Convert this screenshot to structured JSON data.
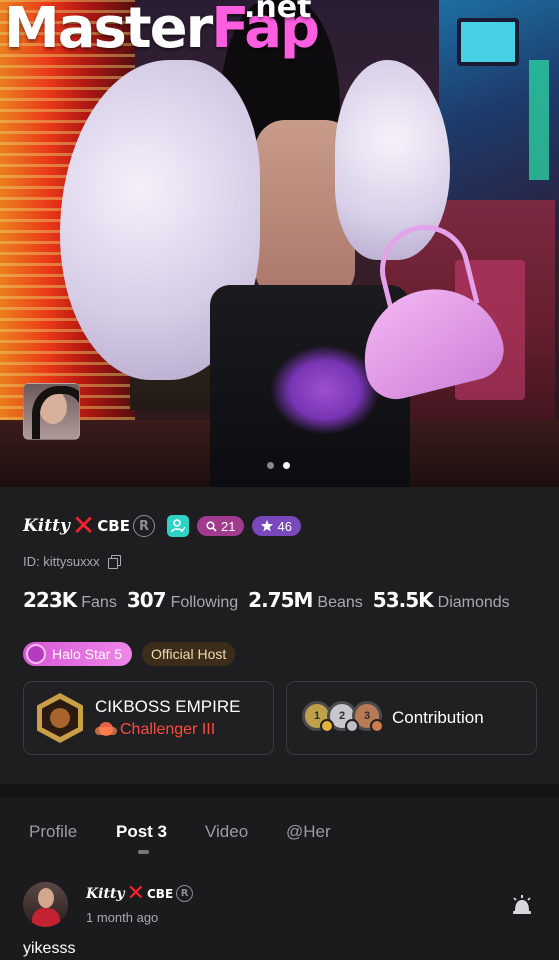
{
  "watermark": {
    "master": "Master",
    "fap": "Fap",
    "net": ".net"
  },
  "gallery": {
    "dot_count": 2,
    "active_dot": 2
  },
  "profile": {
    "name_script": "Kitty",
    "name_x": "✕",
    "name_tag": "CBE",
    "registered_symbol": "R",
    "level_badge": "21",
    "star_badge": "46",
    "id_text": "ID: kittysuxxx",
    "stats": [
      {
        "value": "223K",
        "label": "Fans"
      },
      {
        "value": "307",
        "label": "Following"
      },
      {
        "value": "2.75M",
        "label": "Beans"
      },
      {
        "value": "53.5K",
        "label": "Diamonds"
      }
    ],
    "halo_tag": "Halo Star 5",
    "host_tag": "Official Host",
    "family": {
      "name": "CIKBOSS EMPIRE",
      "rank": "Challenger III"
    },
    "contribution": {
      "label": "Contribution",
      "medals": [
        "1",
        "2",
        "3"
      ]
    }
  },
  "tabs": [
    {
      "label": "Profile",
      "active": false
    },
    {
      "label": "Post 3",
      "active": true
    },
    {
      "label": "Video",
      "active": false
    },
    {
      "label": "@Her",
      "active": false
    }
  ],
  "post": {
    "author_script": "Kitty",
    "author_x": "✕",
    "author_tag": "CBE",
    "registered_symbol": "R",
    "time": "1 month ago",
    "text": "yikesss"
  },
  "colors": {
    "background": "#1b1b1d",
    "level_pill": "#a13b8e",
    "star_pill": "#7a48bd",
    "verify_badge": "#2ed3c6",
    "halo_tag": "#d558d6",
    "host_tag_bg": "#3b2d19",
    "rank_text": "#ff4b3e",
    "watermark_accent": "#ff5ee0"
  }
}
